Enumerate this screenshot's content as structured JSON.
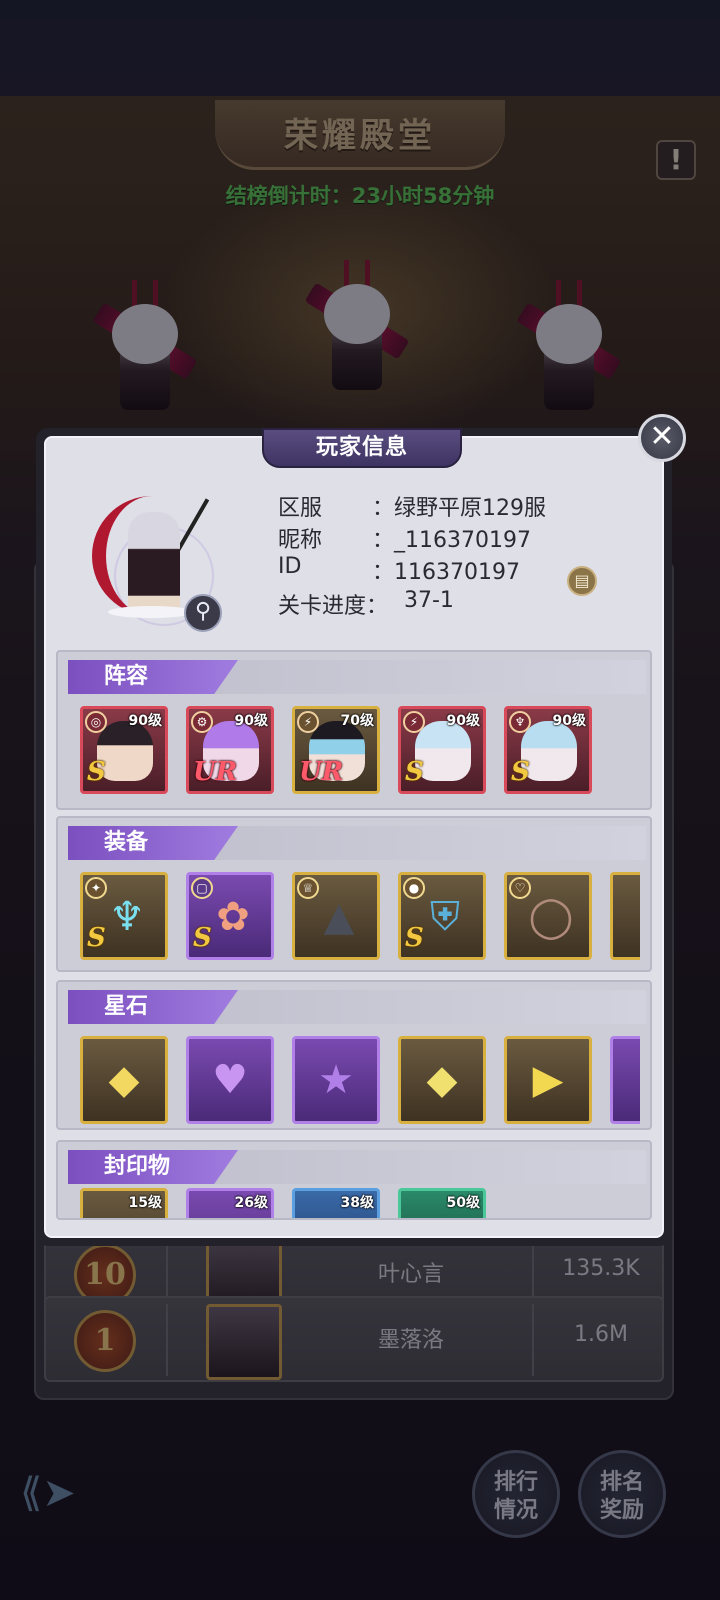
{
  "hall": {
    "title": "荣耀殿堂",
    "countdown": "结榜倒计时：23小时58分钟"
  },
  "rank_list": [
    {
      "rank": "10",
      "name": "叶心言",
      "score": "135.3K"
    },
    {
      "rank": "1",
      "name": "墨落洛",
      "score": "1.6M"
    }
  ],
  "bottom_buttons": {
    "ranking_status": "排行\n情况",
    "ranking_rewards": "排名\n奖励"
  },
  "modal": {
    "title": "玩家信息",
    "close_icon": "close-icon",
    "info": [
      {
        "label": "区服",
        "value": "：绿野平原129服"
      },
      {
        "label": "昵称",
        "value": "：_116370197"
      },
      {
        "label": "ID",
        "value": "：116370197"
      },
      {
        "label": "关卡进度：",
        "value": "37-1"
      }
    ],
    "sections": {
      "lineup": {
        "title": "阵容",
        "heroes": [
          {
            "level": "90级",
            "rarity": "S",
            "frame": "red",
            "class_icon": "swirl-icon"
          },
          {
            "level": "90级",
            "rarity": "UR",
            "frame": "red",
            "class_icon": "gear-icon"
          },
          {
            "level": "70级",
            "rarity": "UR",
            "frame": "gold",
            "class_icon": "wing-icon"
          },
          {
            "level": "90级",
            "rarity": "S",
            "frame": "red",
            "class_icon": "wing-icon"
          },
          {
            "level": "90级",
            "rarity": "S",
            "frame": "red",
            "class_icon": "staff-icon"
          }
        ]
      },
      "equipment": {
        "title": "装备",
        "items": [
          {
            "rarity": "S",
            "frame": "gold",
            "icon": "trident-icon"
          },
          {
            "rarity": "S",
            "frame": "purple",
            "icon": "spellbook-icon"
          },
          {
            "rarity": "",
            "frame": "gold",
            "icon": "witch-hat-icon"
          },
          {
            "rarity": "S",
            "frame": "gold",
            "icon": "armor-icon"
          },
          {
            "rarity": "",
            "frame": "gold",
            "icon": "bracelet-icon"
          }
        ]
      },
      "star_stones": {
        "title": "星石",
        "items": [
          {
            "frame": "gold",
            "icon": "yellow-square-gem-icon"
          },
          {
            "frame": "purple",
            "icon": "purple-heart-gem-icon"
          },
          {
            "frame": "purple",
            "icon": "purple-star-gem-icon"
          },
          {
            "frame": "gold",
            "icon": "yellow-diamond-gem-icon"
          },
          {
            "frame": "gold",
            "icon": "yellow-triangle-gem-icon"
          }
        ]
      },
      "seals": {
        "title": "封印物",
        "items": [
          {
            "level": "15级",
            "frame": "gold"
          },
          {
            "level": "26级",
            "frame": "purple"
          },
          {
            "level": "38级",
            "frame": "blue"
          },
          {
            "level": "50级",
            "frame": "green"
          }
        ]
      }
    }
  },
  "colors": {
    "countdown_green": "#5ec85a",
    "section_purple": "#7b4fbf",
    "panel_bg": "#dfdfe8"
  }
}
